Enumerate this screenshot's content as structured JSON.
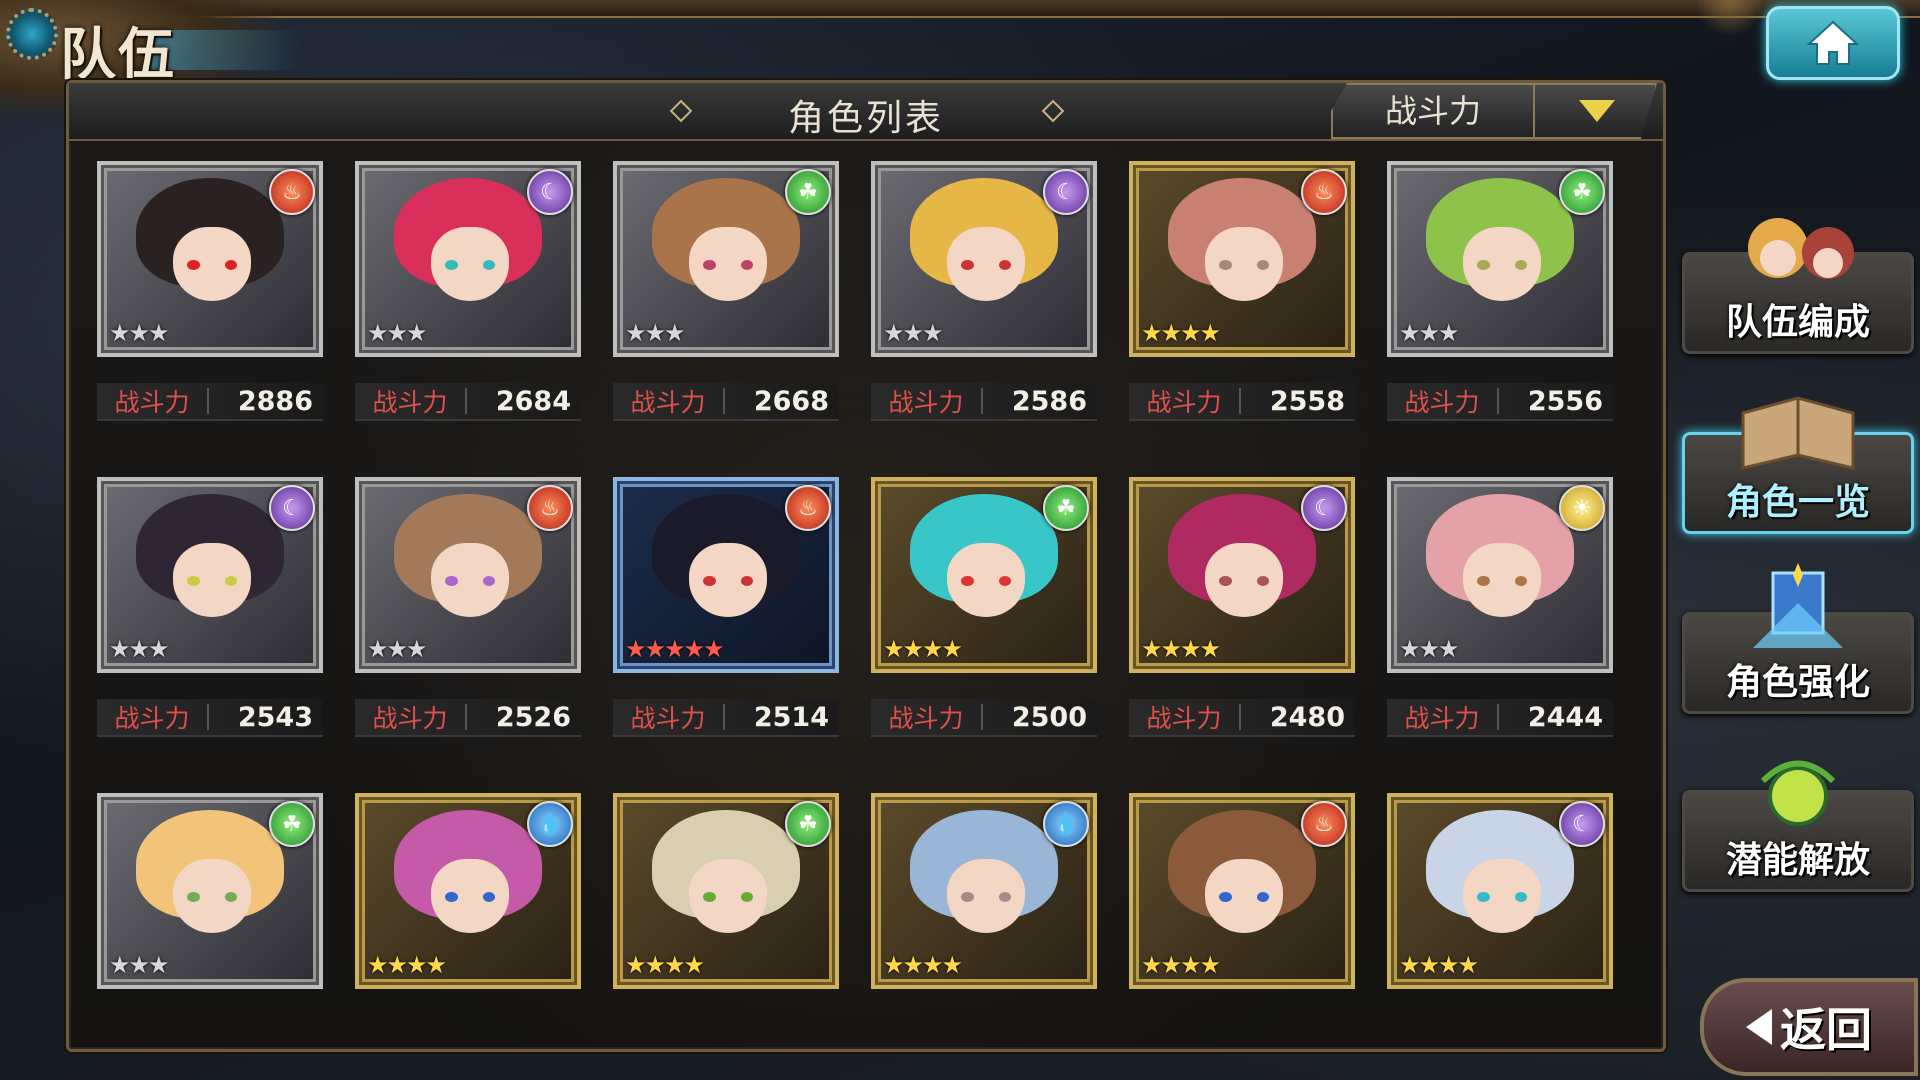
{
  "header": {
    "title": "队伍"
  },
  "panel": {
    "title": "角色列表",
    "sort_label": "战斗力"
  },
  "power_label": "战斗力",
  "characters": [
    {
      "element": "fire",
      "rarity": 3,
      "power": "2886",
      "frame": "silver",
      "hair": "#2a2222",
      "eye": "#d22"
    },
    {
      "element": "dark",
      "rarity": 3,
      "power": "2684",
      "frame": "silver",
      "hair": "#d8305a",
      "eye": "#3bb"
    },
    {
      "element": "wind",
      "rarity": 3,
      "power": "2668",
      "frame": "silver",
      "hair": "#a9744a",
      "eye": "#b46"
    },
    {
      "element": "dark",
      "rarity": 3,
      "power": "2586",
      "frame": "silver",
      "hair": "#e6b646",
      "eye": "#c33"
    },
    {
      "element": "fire",
      "rarity": 4,
      "power": "2558",
      "frame": "gold",
      "hair": "#c88070",
      "eye": "#a87"
    },
    {
      "element": "wind",
      "rarity": 3,
      "power": "2556",
      "frame": "silver",
      "hair": "#8fc24a",
      "eye": "#aa5"
    },
    {
      "element": "dark",
      "rarity": 3,
      "power": "2543",
      "frame": "silver",
      "hair": "#2e2632",
      "eye": "#cc4"
    },
    {
      "element": "fire",
      "rarity": 3,
      "power": "2526",
      "frame": "silver",
      "hair": "#a27a5a",
      "eye": "#a6c"
    },
    {
      "element": "fire",
      "rarity": 5,
      "power": "2514",
      "frame": "blue",
      "hair": "#1a1a2a",
      "eye": "#c33"
    },
    {
      "element": "wind",
      "rarity": 4,
      "power": "2500",
      "frame": "gold",
      "hair": "#38c6c8",
      "eye": "#d33"
    },
    {
      "element": "dark",
      "rarity": 4,
      "power": "2480",
      "frame": "gold",
      "hair": "#b02a62",
      "eye": "#a55"
    },
    {
      "element": "light",
      "rarity": 3,
      "power": "2444",
      "frame": "silver",
      "hair": "#e4a2a8",
      "eye": "#a74"
    },
    {
      "element": "wind",
      "rarity": 3,
      "power": "",
      "frame": "silver",
      "hair": "#f1c47a",
      "eye": "#7a5"
    },
    {
      "element": "water",
      "rarity": 4,
      "power": "",
      "frame": "gold",
      "hair": "#c45aa8",
      "eye": "#36c"
    },
    {
      "element": "wind",
      "rarity": 4,
      "power": "",
      "frame": "gold",
      "hair": "#d8cfb0",
      "eye": "#6a3"
    },
    {
      "element": "water",
      "rarity": 4,
      "power": "",
      "frame": "gold",
      "hair": "#9ab6d6",
      "eye": "#a88"
    },
    {
      "element": "fire",
      "rarity": 4,
      "power": "",
      "frame": "gold",
      "hair": "#8a5a3a",
      "eye": "#36c"
    },
    {
      "element": "dark",
      "rarity": 4,
      "power": "",
      "frame": "gold",
      "hair": "#c9d4e6",
      "eye": "#3bc"
    }
  ],
  "side_menu": [
    {
      "label": "队伍编成",
      "active": false
    },
    {
      "label": "角色一览",
      "active": true
    },
    {
      "label": "角色强化",
      "active": false
    },
    {
      "label": "潜能解放",
      "active": false
    }
  ],
  "back_label": "返回",
  "colors": {
    "accent": "#6ad3ec",
    "power_label": "#e0504a",
    "sort_arrow": "#ecd24a"
  }
}
